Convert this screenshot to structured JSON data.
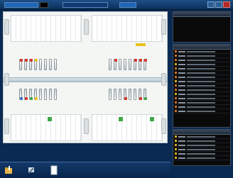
{
  "window": {
    "title_bar_segments": [
      "",
      "",
      "",
      ""
    ],
    "controls": [
      "minimize-icon",
      "maximize-icon",
      "close-icon"
    ]
  },
  "colors": {
    "desktop": "#0b2a52",
    "chart_background": "#f4f6f4",
    "panel_background": "#0a0a0a",
    "marker_red": "#d6352b",
    "marker_yellow": "#e8c21d",
    "marker_green": "#3fa846",
    "marker_blue": "#3a6fd0"
  },
  "dental_chart": {
    "upper_left_markers": [
      "red",
      "red",
      "red",
      "yellow",
      "none",
      "none",
      "none",
      "none"
    ],
    "upper_right_markers": [
      "none",
      "red",
      "none",
      "none",
      "none",
      "red",
      "red",
      "red"
    ],
    "lower_left_markers": [
      "blue",
      "red",
      "green",
      "yellow",
      "none",
      "none",
      "none",
      "none"
    ],
    "lower_right_markers": [
      "none",
      "none",
      "none",
      "red",
      "none",
      "none",
      "red",
      "green"
    ]
  },
  "side_panels": {
    "top": {
      "header": "",
      "rows": 0
    },
    "middle": {
      "header": "",
      "rows": 15,
      "row_icon_colors": [
        "#e07a2e",
        "#e07a2e",
        "#e07a2e",
        "#e8c21d",
        "#e07a2e",
        "#e07a2e",
        "#e07a2e",
        "#e8c21d",
        "#e07a2e",
        "#e07a2e",
        "#e8c21d",
        "#e07a2e",
        "#e07a2e",
        "#e07a2e",
        "#e07a2e"
      ]
    },
    "bottom": {
      "header": "",
      "rows": 6,
      "row_icon_colors": [
        "#e8c21d",
        "#e8c21d",
        "#e8c21d",
        "#e8c21d",
        "#e8c21d",
        "#e8c21d"
      ]
    }
  },
  "taskbar": {
    "icons": [
      "folder-icon",
      "tools-icon",
      "document-icon"
    ]
  }
}
